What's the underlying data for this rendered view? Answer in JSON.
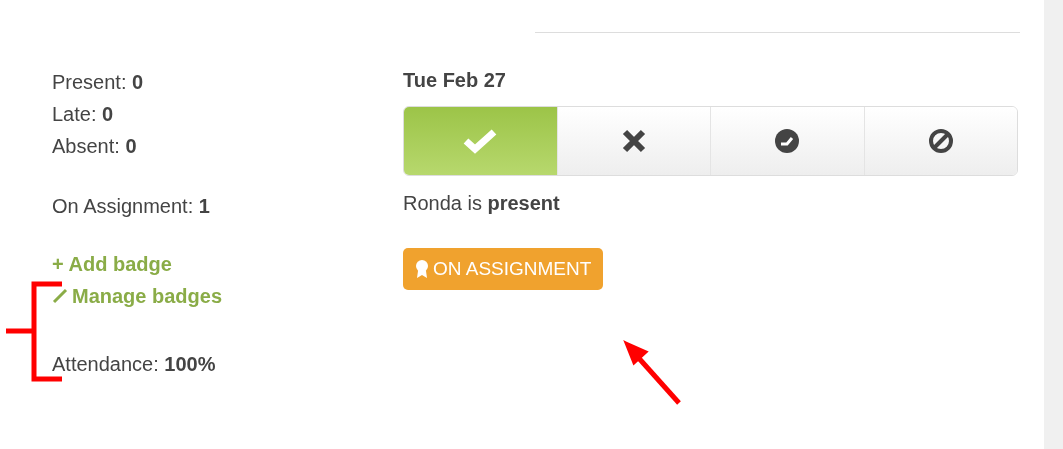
{
  "stats": [
    {
      "label": "Present:",
      "value": "0"
    },
    {
      "label": "Late:",
      "value": "0"
    },
    {
      "label": "Absent:",
      "value": "0"
    },
    {
      "label": "On Assignment:",
      "value": "1"
    }
  ],
  "links": [
    {
      "kind": "add",
      "label": "+ Add badge"
    },
    {
      "kind": "manage",
      "label": "Manage badges"
    }
  ],
  "attendance": {
    "label": "Attendance:",
    "value": "100%"
  },
  "date": "Tue Feb 27",
  "status_buttons": [
    {
      "kind": "present",
      "selected": true
    },
    {
      "kind": "absent",
      "selected": false
    },
    {
      "kind": "late",
      "selected": false
    },
    {
      "kind": "excused",
      "selected": false
    }
  ],
  "status_text": "Ronda is **present**",
  "badge": {
    "label": "ON ASSIGNMENT"
  }
}
